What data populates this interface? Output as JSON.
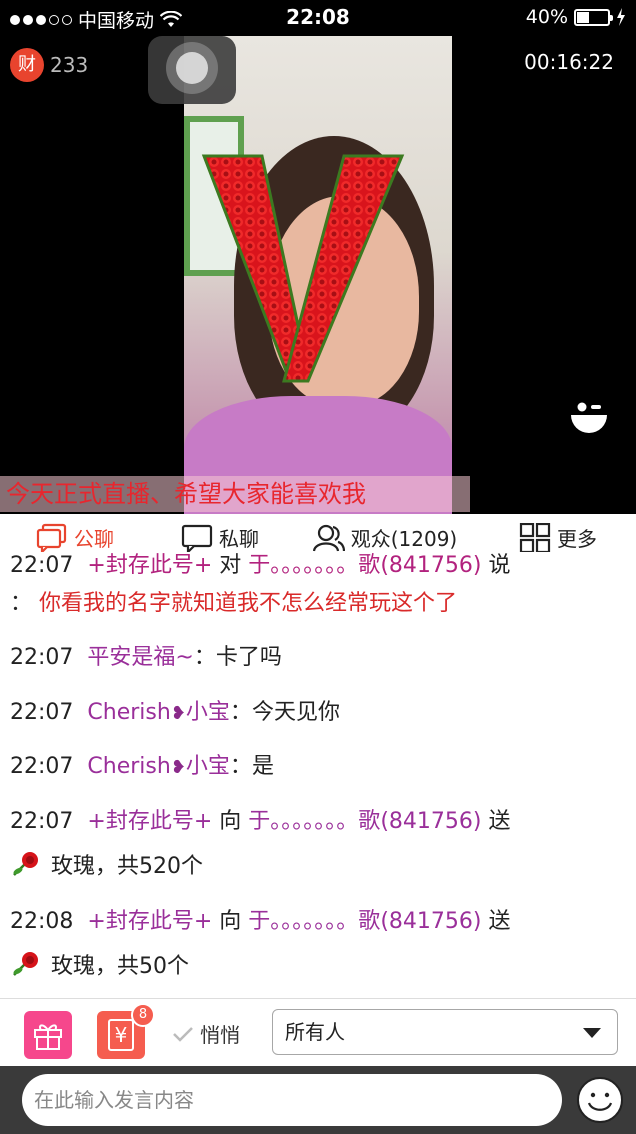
{
  "status_bar": {
    "carrier": "中国移动",
    "time": "22:08",
    "battery": "40%",
    "battery_level": 0.4
  },
  "live": {
    "wealth_badge": "财",
    "wealth_count": "233",
    "duration": "00:16:22",
    "banner": "今天正式直播、希望大家能喜欢我"
  },
  "tabs": [
    {
      "label": "公聊",
      "active": true
    },
    {
      "label": "私聊"
    },
    {
      "label": "观众(1209)"
    },
    {
      "label": "更多"
    }
  ],
  "chat": {
    "m0": {
      "time": "22:07",
      "from": "+封存此号+",
      "verb": "对",
      "to": "于。。。。。。。歌",
      "to_id": "(841756)",
      "tail": "说"
    },
    "m0_body": "你看我的名字就知道我不怎么经常玩这个了",
    "m1": {
      "time": "22:07",
      "from": "平安是福~",
      "text": "卡了吗"
    },
    "m2": {
      "time": "22:07",
      "from_a": "Cherish",
      "heart": "❥",
      "from_b": "小宝",
      "text": "今天见你"
    },
    "m3": {
      "time": "22:07",
      "from_a": "Cherish",
      "heart": "❥",
      "from_b": "小宝",
      "text": "是"
    },
    "m4": {
      "time": "22:07",
      "from": "+封存此号+",
      "verb": "向",
      "to": "于。。。。。。。歌",
      "to_id": "(841756)",
      "tail": "送",
      "gift": "玫瑰，共520个"
    },
    "m5": {
      "time": "22:08",
      "from": "+封存此号+",
      "verb": "向",
      "to": "于。。。。。。。歌",
      "to_id": "(841756)",
      "tail": "送",
      "gift": "玫瑰，共50个"
    }
  },
  "controls": {
    "red_packet_badge": "8",
    "red_packet_char": "¥",
    "whisper_label": "悄悄",
    "recipient": "所有人"
  },
  "input": {
    "placeholder": "在此输入发言内容"
  },
  "colors": {
    "accent": "#e8442e",
    "gift": "#f6478c",
    "red_packet": "#f55d4f",
    "nickname": "#9a2f9a"
  }
}
